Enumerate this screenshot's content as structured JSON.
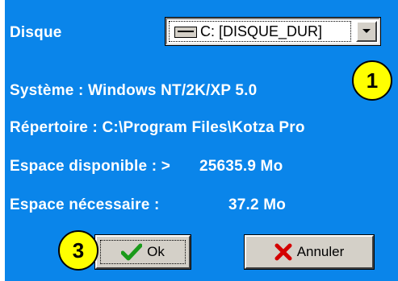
{
  "disk": {
    "label": "Disque",
    "selected": "C: [DISQUE_DUR]"
  },
  "info": {
    "system": "Système : Windows NT/2K/XP 5.0",
    "directory": "Répertoire : C:\\Program Files\\Kotza Pro",
    "available_label": "Espace disponible : >",
    "available_value": "25635.9 Mo",
    "required_label": "Espace nécessaire :",
    "required_value": "37.2 Mo"
  },
  "badges": {
    "first": "1",
    "third": "3"
  },
  "buttons": {
    "ok": "Ok",
    "cancel": "Annuler"
  },
  "colors": {
    "background": "#0a85ea",
    "badge": "#ffff00",
    "ok_check": "#1a9a1a",
    "cancel_x": "#d40000"
  }
}
